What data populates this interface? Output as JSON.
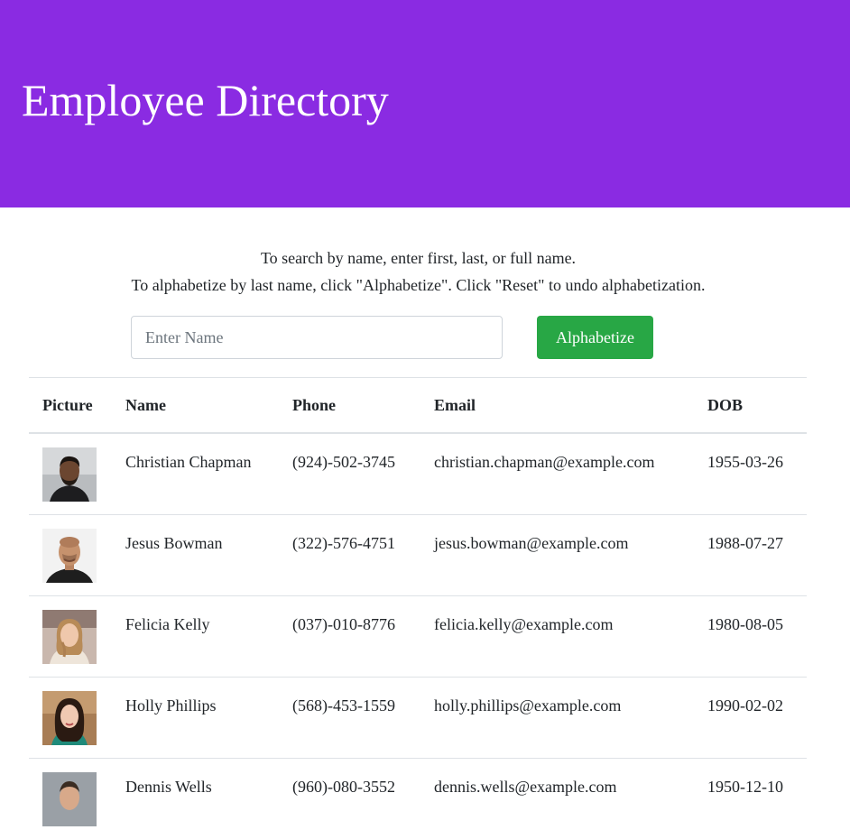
{
  "header": {
    "title": "Employee Directory",
    "background": "#8a2be2"
  },
  "instructions": {
    "line1": "To search by name, enter first, last, or full name.",
    "line2": "To alphabetize by last name, click \"Alphabetize\". Click \"Reset\" to undo alphabetization."
  },
  "search": {
    "placeholder": "Enter Name",
    "value": ""
  },
  "controls": {
    "alphabetize_label": "Alphabetize",
    "button_color": "#28a745"
  },
  "table": {
    "headers": [
      "Picture",
      "Name",
      "Phone",
      "Email",
      "DOB"
    ],
    "rows": [
      {
        "picture": "portrait-man-beard",
        "name": "Christian Chapman",
        "phone": "(924)-502-3745",
        "email": "christian.chapman@example.com",
        "dob": "1955-03-26"
      },
      {
        "picture": "portrait-man-bald",
        "name": "Jesus Bowman",
        "phone": "(322)-576-4751",
        "email": "jesus.bowman@example.com",
        "dob": "1988-07-27"
      },
      {
        "picture": "portrait-woman-blonde",
        "name": "Felicia Kelly",
        "phone": "(037)-010-8776",
        "email": "felicia.kelly@example.com",
        "dob": "1980-08-05"
      },
      {
        "picture": "portrait-woman-brunette",
        "name": "Holly Phillips",
        "phone": "(568)-453-1559",
        "email": "holly.phillips@example.com",
        "dob": "1990-02-02"
      },
      {
        "picture": "portrait-man",
        "name": "Dennis Wells",
        "phone": "(960)-080-3552",
        "email": "dennis.wells@example.com",
        "dob": "1950-12-10"
      }
    ]
  }
}
